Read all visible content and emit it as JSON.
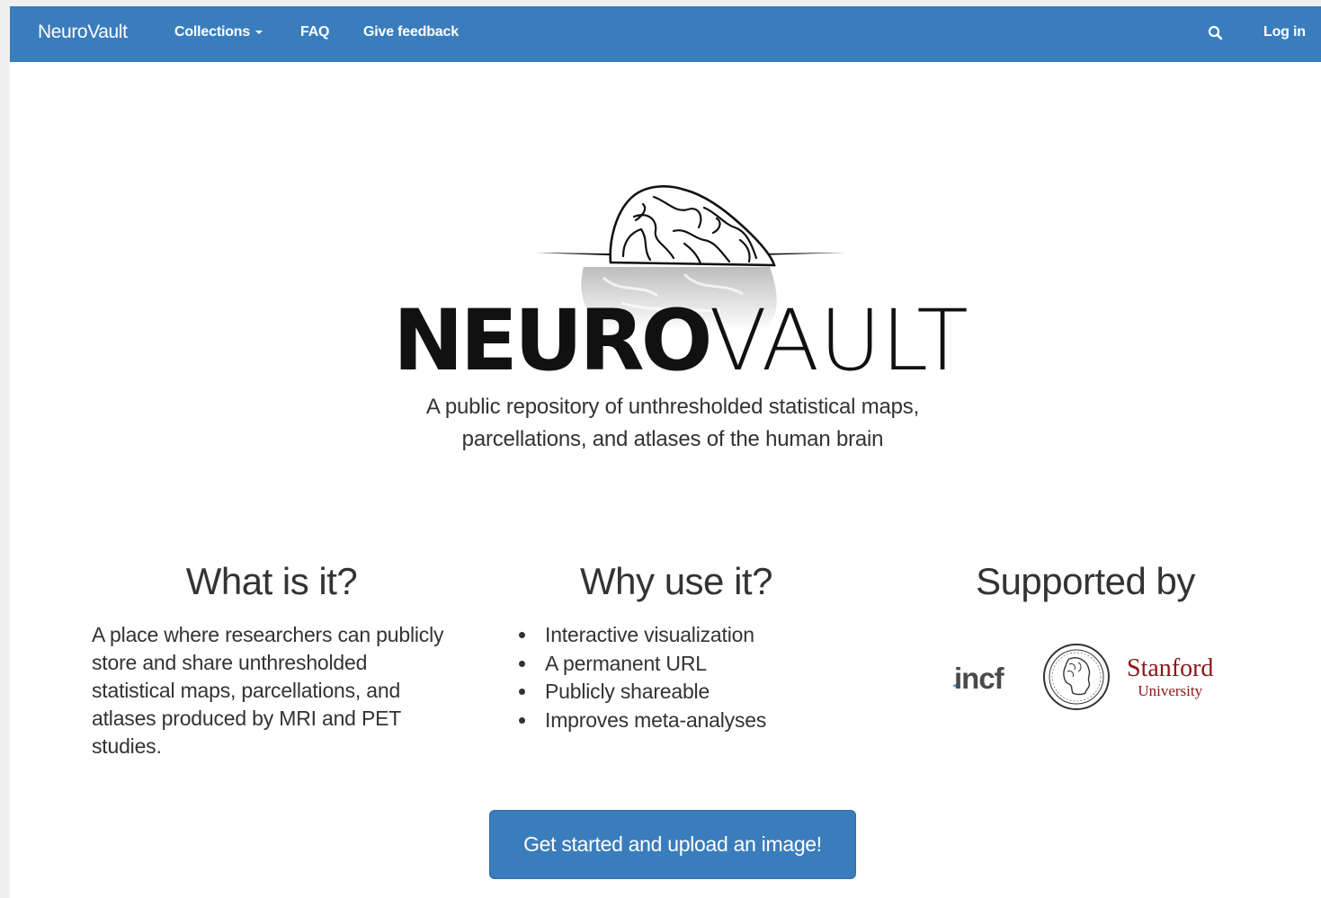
{
  "navbar": {
    "brand": "NeuroVault",
    "items": [
      {
        "label": "Collections",
        "has_dropdown": true
      },
      {
        "label": "FAQ"
      },
      {
        "label": "Give feedback"
      }
    ],
    "search_icon": "search-icon",
    "login_label": "Log in",
    "background_color": "#3a7dbd"
  },
  "hero": {
    "logo_text_bold": "NEURO",
    "logo_text_thin": "VAULT",
    "tagline_line1": "A public repository of unthresholded statistical maps,",
    "tagline_line2": "parcellations, and atlases of the human brain"
  },
  "columns": {
    "what": {
      "heading": "What is it?",
      "text": "A place where researchers can publicly store and share unthresholded statistical maps, parcellations, and atlases produced by MRI and PET studies."
    },
    "why": {
      "heading": "Why use it?",
      "items": [
        "Interactive visualization",
        "A permanent URL",
        "Publicly shareable",
        "Improves meta-analyses"
      ]
    },
    "supported": {
      "heading": "Supported by",
      "logos": [
        {
          "name": "incf-logo",
          "text": "incf"
        },
        {
          "name": "max-planck-logo"
        },
        {
          "name": "stanford-logo",
          "text_line1": "Stanford",
          "text_line2": "University"
        }
      ]
    }
  },
  "cta": {
    "label": "Get started and upload an image!",
    "color": "#3a7dbd"
  }
}
